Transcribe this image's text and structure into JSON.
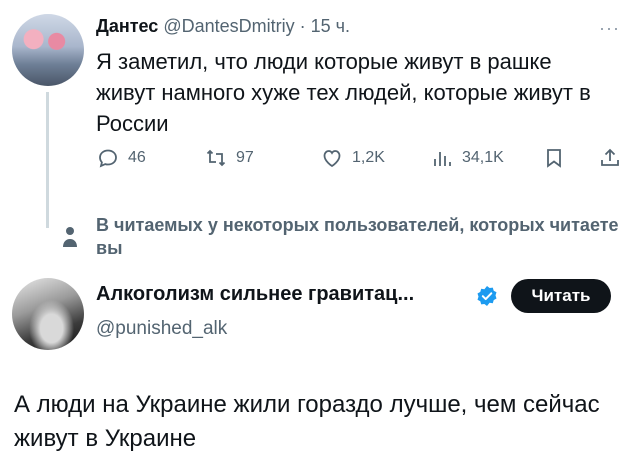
{
  "tweet1": {
    "name": "Дантес",
    "handle": "@DantesDmitriy",
    "separator": "·",
    "time": "15 ч.",
    "more": "···",
    "text": "Я заметил, что люди которые живут в рашке живут намного хуже  тех людей, которые живут в России",
    "actions": {
      "replies": "46",
      "reposts": "97",
      "likes": "1,2K",
      "views": "34,1K"
    }
  },
  "context": {
    "text": "В читаемых у некоторых пользователей, которых читаете вы"
  },
  "tweet2": {
    "name": "Алкоголизм сильнее гравитац...",
    "handle": "@punished_alk",
    "follow_label": "Читать",
    "text": "А люди на Украине жили гораздо лучше, чем сейчас живут в Украине"
  },
  "colors": {
    "text": "#0f1419",
    "secondary": "#536471",
    "verified": "#1d9bf0",
    "button": "#0f1419"
  }
}
